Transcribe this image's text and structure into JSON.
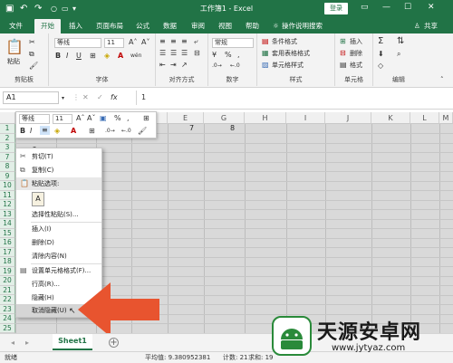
{
  "title_bar": {
    "doc_title": "工作簿1 - Excel",
    "login": "登录",
    "save_icon": "save-icon",
    "undo_icon": "undo-icon",
    "redo_icon": "redo-icon"
  },
  "tabs": [
    "文件",
    "开始",
    "插入",
    "页面布局",
    "公式",
    "数据",
    "审阅",
    "视图",
    "帮助"
  ],
  "active_tab": "开始",
  "tell_me": "操作说明搜索",
  "share": "共享",
  "ribbon": {
    "clipboard": {
      "paste": "粘贴",
      "label": "剪贴板"
    },
    "font": {
      "name": "等线",
      "size": "11",
      "label": "字体",
      "bold": "B",
      "italic": "I",
      "underline": "U",
      "grow": "A˄",
      "shrink": "A˅",
      "font_color": "A",
      "wen": "wén"
    },
    "alignment": {
      "label": "对齐方式"
    },
    "number": {
      "format": "常规",
      "label": "数字",
      "percent": "%",
      "comma": ","
    },
    "styles": {
      "conditional": "条件格式",
      "table": "套用表格格式",
      "cell": "单元格样式",
      "label": "样式"
    },
    "cells": {
      "insert": "插入",
      "delete": "删除",
      "format": "格式",
      "label": "单元格"
    },
    "editing": {
      "label": "编辑"
    }
  },
  "formula_bar": {
    "name_box": "A1",
    "fx": "fx",
    "value": "1",
    "cancel": "✕",
    "confirm": "✓"
  },
  "columns": [
    "A",
    "B",
    "C",
    "D",
    "E",
    "F",
    "G",
    "H",
    "I",
    "J",
    "K",
    "L",
    "M"
  ],
  "rows": [
    "1",
    "2",
    "3",
    "7",
    "8",
    "9",
    "10",
    "11",
    "12",
    "13",
    "14",
    "15",
    "16",
    "17",
    "18",
    "19",
    "20",
    "21",
    "22",
    "23",
    "24",
    "25",
    "26"
  ],
  "cells": {
    "g1": "7",
    "h1": "8",
    "b3": "2"
  },
  "mini_toolbar": {
    "font": "等线",
    "size": "11",
    "percent": "%",
    "comma": ","
  },
  "context_menu": {
    "cut": "剪切(T)",
    "copy": "复制(C)",
    "paste_options": "粘贴选项:",
    "paste_special": "选择性粘贴(S)...",
    "insert": "插入(I)",
    "delete": "删除(D)",
    "clear": "清除内容(N)",
    "format_cells": "设置单元格格式(F)...",
    "row_height": "行高(R)...",
    "hide": "隐藏(H)",
    "unhide": "取消隐藏(U)"
  },
  "sheet": {
    "name": "Sheet1",
    "add": "+"
  },
  "status": {
    "ready": "就绪",
    "average": "平均值: 9.380952381",
    "count": "计数: 21",
    "sum": "求和: 19"
  },
  "watermark": {
    "name": "天源安卓网",
    "url": "www.jytyaz.com"
  },
  "colors": {
    "excel_green": "#217346",
    "arrow": "#e8542f"
  }
}
